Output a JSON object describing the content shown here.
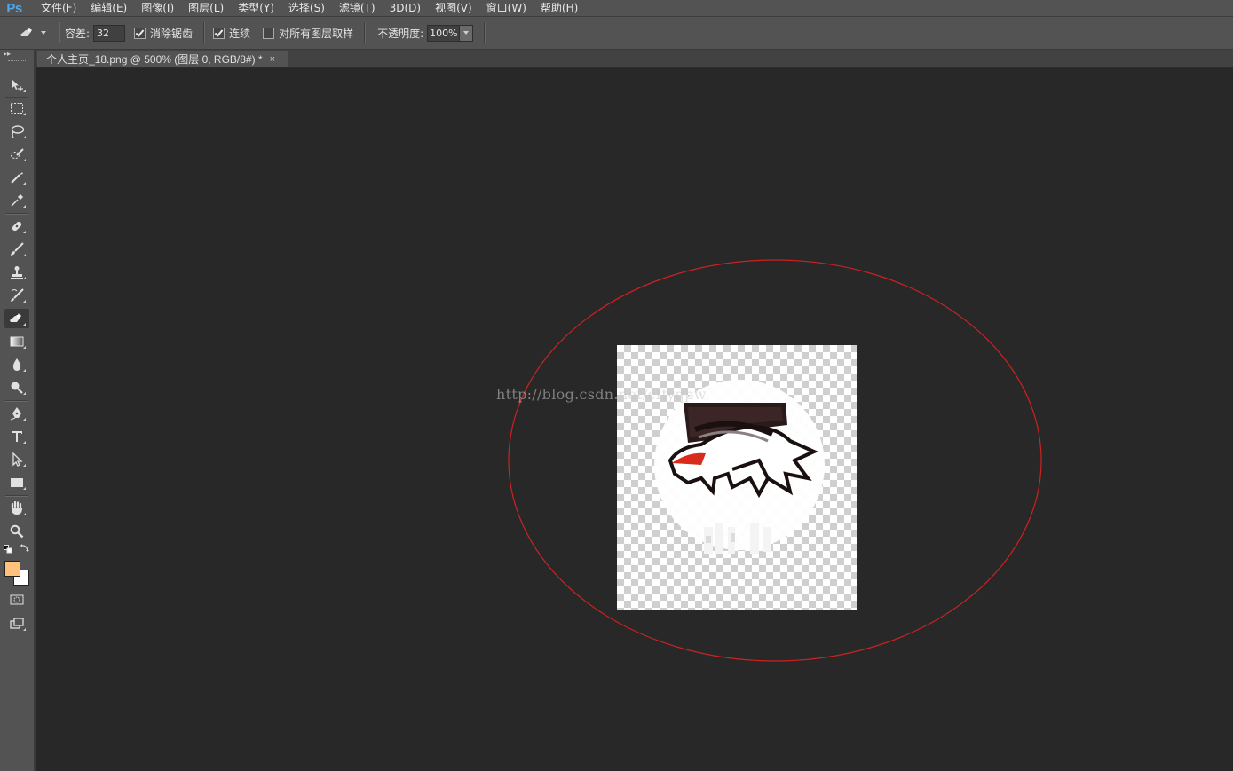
{
  "app": {
    "logo": "Ps"
  },
  "menu": {
    "items": [
      "文件(F)",
      "编辑(E)",
      "图像(I)",
      "图层(L)",
      "类型(Y)",
      "选择(S)",
      "滤镜(T)",
      "3D(D)",
      "视图(V)",
      "窗口(W)",
      "帮助(H)"
    ]
  },
  "options": {
    "tool_icon": "magic-eraser-icon",
    "tolerance_label": "容差:",
    "tolerance_value": "32",
    "antialias_label": "消除锯齿",
    "antialias_checked": true,
    "contiguous_label": "连续",
    "contiguous_checked": true,
    "sample_all_label": "对所有图层取样",
    "sample_all_checked": false,
    "opacity_label": "不透明度:",
    "opacity_value": "100%"
  },
  "document": {
    "tab_title": "个人主页_18.png @ 500% (图层 0, RGB/8#) *",
    "tab_close": "×",
    "watermark": "http://blog.csdn.net/cffyqpw"
  },
  "toolbox": {
    "tools": [
      "move-icon",
      "marquee-icon",
      "lasso-icon",
      "quick-select-icon",
      "crop-icon",
      "eyedropper-icon",
      "healing-brush-icon",
      "brush-icon",
      "clone-stamp-icon",
      "history-brush-icon",
      "eraser-icon",
      "gradient-icon",
      "blur-icon",
      "dodge-icon",
      "pen-icon",
      "type-icon",
      "path-select-icon",
      "rectangle-icon",
      "hand-icon",
      "zoom-icon"
    ],
    "active_tool": "eraser-icon",
    "foreground_color": "#ffc27c",
    "background_color": "#ffffff"
  },
  "colors": {
    "annotation": "#cc2222",
    "accent": "#4fa8e8"
  }
}
